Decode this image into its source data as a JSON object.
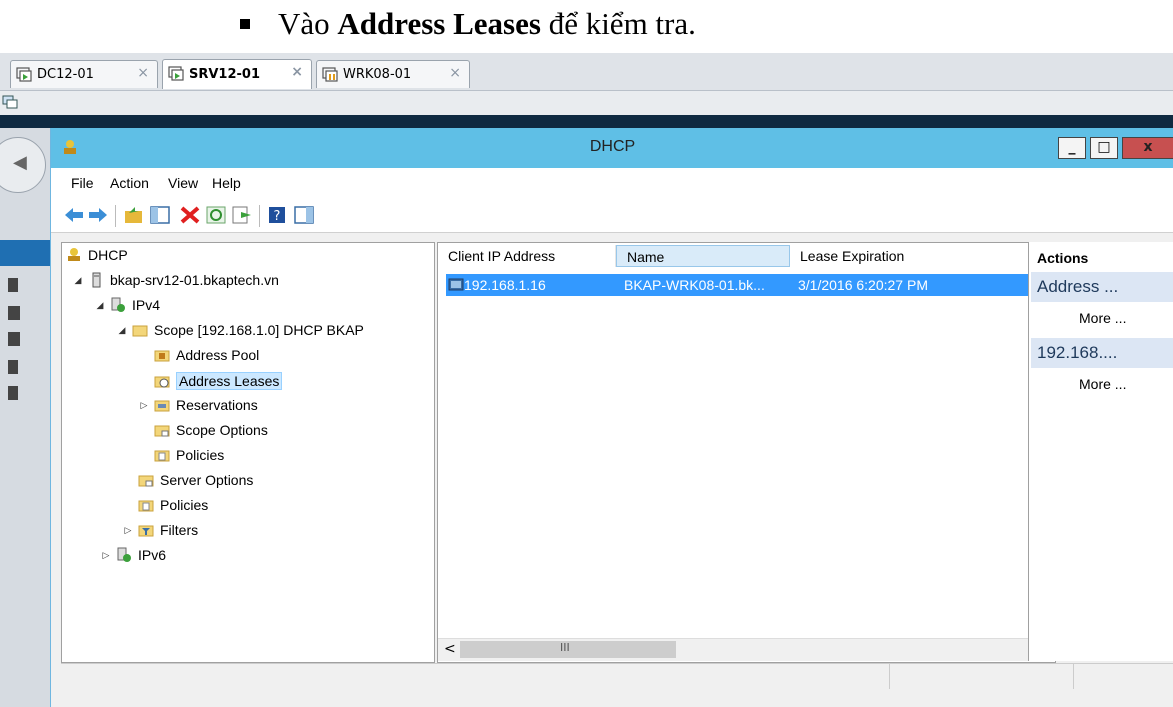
{
  "caption": {
    "prefix": "Vào ",
    "bold": "Address Leases",
    "suffix": " để kiểm tra."
  },
  "vm_tabs": [
    {
      "label": "DC12-01",
      "active": false
    },
    {
      "label": "SRV12-01",
      "active": true
    },
    {
      "label": "WRK08-01",
      "active": false
    }
  ],
  "window": {
    "title": "DHCP",
    "minimize": "_",
    "maximize": "□",
    "close": "x"
  },
  "menu": [
    "File",
    "Action",
    "View",
    "Help"
  ],
  "tree": [
    {
      "label": "DHCP",
      "icon": "dhcp-icon",
      "expander": ""
    },
    {
      "label": "bkap-srv12-01.bkaptech.vn",
      "icon": "server-icon",
      "expander": "◢"
    },
    {
      "label": "IPv4",
      "icon": "ipv4-icon",
      "expander": "◢"
    },
    {
      "label": "Scope [192.168.1.0] DHCP BKAP",
      "icon": "folder-icon",
      "expander": "◢"
    },
    {
      "label": "Address Pool",
      "icon": "address-pool-icon",
      "expander": ""
    },
    {
      "label": "Address Leases",
      "icon": "address-leases-icon",
      "expander": "",
      "selected": true
    },
    {
      "label": "Reservations",
      "icon": "reservations-icon",
      "expander": "▷"
    },
    {
      "label": "Scope Options",
      "icon": "scope-options-icon",
      "expander": ""
    },
    {
      "label": "Policies",
      "icon": "policies-icon",
      "expander": ""
    },
    {
      "label": "Server Options",
      "icon": "server-options-icon",
      "expander": ""
    },
    {
      "label": "Policies",
      "icon": "policies-icon",
      "expander": ""
    },
    {
      "label": "Filters",
      "icon": "filters-icon",
      "expander": "▷"
    },
    {
      "label": "IPv6",
      "icon": "ipv6-icon",
      "expander": "▷"
    }
  ],
  "list": {
    "columns": [
      "Client IP Address",
      "Name",
      "Lease Expiration"
    ],
    "rows": [
      {
        "ip": "192.168.1.16",
        "name": "BKAP-WRK08-01.bk...",
        "expiration": "3/1/2016 6:20:27 PM"
      }
    ],
    "scroll_left": "<",
    "scroll_mid": "III",
    "scroll_right": ">"
  },
  "actions": {
    "header": "Actions",
    "groups": [
      {
        "title": "Address ...",
        "more": "More ..."
      },
      {
        "title": "192.168....",
        "more": "More ..."
      }
    ]
  },
  "colors": {
    "titlebar": "#5fbfe6",
    "selection": "#3399ff",
    "close": "#c75050"
  }
}
